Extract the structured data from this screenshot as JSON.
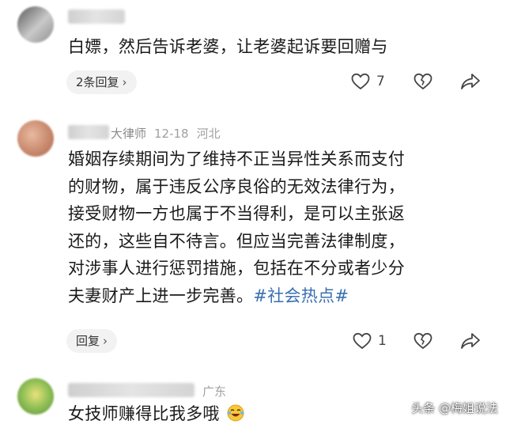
{
  "comments": [
    {
      "text": "白嫖，然后告诉老婆，让老婆起诉要回赠与",
      "replies_label": "2条回复",
      "like_count": "7"
    },
    {
      "author_suffix": "大律师",
      "date": "12-18",
      "location": "河北",
      "lines": [
        "婚姻存续期间为了维持不正当异性关系而支付",
        "的财物，属于违反公序良俗的无效法律行为，",
        "接受财物一方也属于不当得利，是可以主张返",
        "还的，这些自不待言。但应当完善法律制度，",
        "对涉事人进行惩罚措施，包括在不分或者少分"
      ],
      "last_line": "夫妻财产上进一步完善。",
      "hashtag": "#社会热点#",
      "reply_label": "回复",
      "like_count": "1"
    },
    {
      "location": "广东",
      "text": "女技师赚得比我多哦"
    }
  ],
  "icons": {
    "like": "heart-outline-icon",
    "dislike": "broken-heart-icon",
    "share": "share-arrow-icon",
    "chevron": "chevron-right-icon",
    "emoji": "laughing-crying-emoji-icon"
  },
  "watermark": "头条 @梅姐说法",
  "colors": {
    "hashtag": "#3a6fb0",
    "pill_bg": "#f2f2f2",
    "meta": "#a0a0a0"
  }
}
